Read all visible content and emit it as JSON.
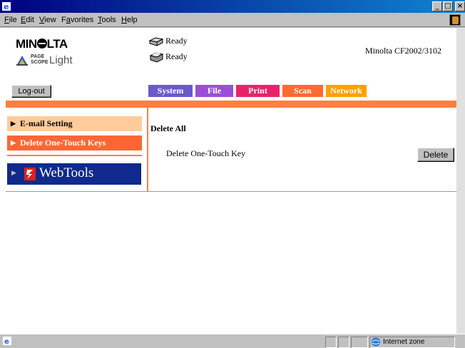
{
  "window": {
    "menu": [
      {
        "label": "File",
        "key": "F"
      },
      {
        "label": "Edit",
        "key": "E"
      },
      {
        "label": "View",
        "key": "V"
      },
      {
        "label": "Favorites",
        "key": "a"
      },
      {
        "label": "Tools",
        "key": "T"
      },
      {
        "label": "Help",
        "key": "H"
      }
    ]
  },
  "header": {
    "brand": "MIN",
    "brand_suffix": "LTA",
    "pagescope_top": "PAGE",
    "pagescope_bottom": "SCOPE",
    "pagescope_light": "Light",
    "status": [
      {
        "text": "Ready",
        "icon": "scanner-icon"
      },
      {
        "text": "Ready",
        "icon": "printer-icon"
      }
    ],
    "model": "Minolta CF2002/3102",
    "logout_label": "Log-out"
  },
  "tabs": [
    {
      "label": "System",
      "color": "#6a5acd"
    },
    {
      "label": "File",
      "color": "#9a4fd6"
    },
    {
      "label": "Print",
      "color": "#e8236a"
    },
    {
      "label": "Scan",
      "color": "#ff6a30"
    },
    {
      "label": "Network",
      "color": "#ffa000"
    }
  ],
  "sidebar": {
    "items": [
      {
        "label": "E-mail Setting",
        "bg": "#ffcc99",
        "color": "#000000"
      },
      {
        "label": "Delete One-Touch Keys",
        "bg": "#ff6633",
        "color": "#ffffff"
      }
    ],
    "webtools_label": "WebTools"
  },
  "main": {
    "title": "Delete All",
    "row_label": "Delete One-Touch Key",
    "delete_label": "Delete"
  },
  "statusbar": {
    "zone": "Internet zone"
  },
  "colors": {
    "accent": "#ff7f3f",
    "titlebar": "#000080"
  }
}
